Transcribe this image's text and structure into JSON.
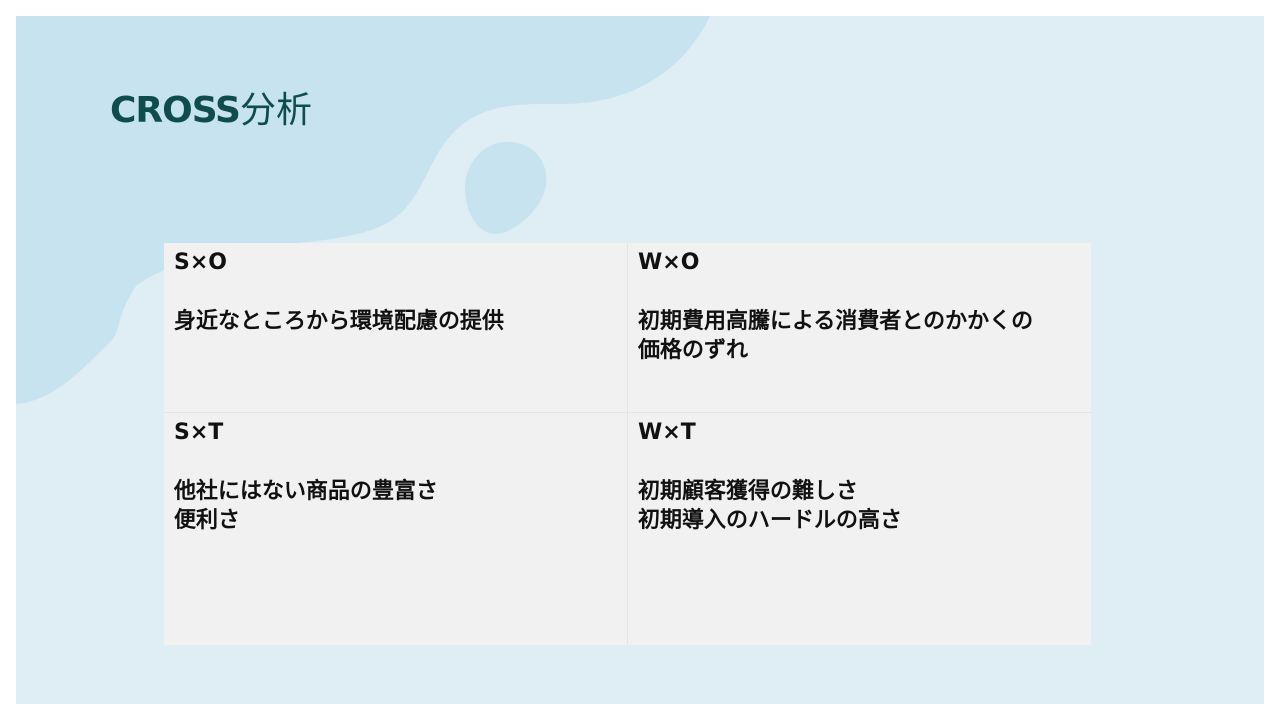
{
  "slide": {
    "title_latin": "CROSS",
    "title_jp": "分析",
    "colors": {
      "background": "#dfedf4",
      "blob": "#c6e3ef",
      "title": "#0f4c4f",
      "table": "#f1f1f1"
    }
  },
  "matrix": {
    "cells": [
      {
        "heading": "S×O",
        "lines": [
          "身近なところから環境配慮の提供"
        ]
      },
      {
        "heading": "W×O",
        "lines": [
          "初期費用高騰による消費者とのかかくの",
          "価格のずれ"
        ]
      },
      {
        "heading": "S×T",
        "lines": [
          "他社にはない商品の豊富さ",
          "便利さ"
        ]
      },
      {
        "heading": "W×T",
        "lines": [
          "初期顧客獲得の難しさ",
          "初期導入のハードルの高さ"
        ]
      }
    ]
  }
}
